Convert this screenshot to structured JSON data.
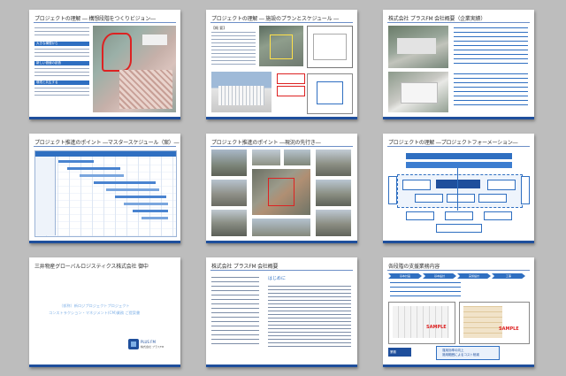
{
  "slides": [
    {
      "title": "プロジェクトの理解 ― 構想段階をつくりビジョン―",
      "bars": [
        "大きな構想から",
        "新しい価値の創造",
        "環境と共生する"
      ]
    },
    {
      "title": "プロジェクトの理解 ― 施設のプランとスケジュール ―",
      "heading": "【概 要】"
    },
    {
      "title": "株式会社 プラスFM 会社概要（企業実績）"
    },
    {
      "title": "プロジェクト推進のポイント ―マスタースケジュール（案）―"
    },
    {
      "title": "プロジェクト推進のポイント ―現況の先行き―"
    },
    {
      "title": "プロジェクトの理解 ―プロジェクトフォーメーション―"
    },
    {
      "title": "三井物産グローバルロジスティクス株式会社 御中",
      "subtitle": "（仮称）新ロジプロジェクトプロジェクト",
      "subtitle2": "コンストラクション・マネジメント(CM)業務 ご提案書",
      "brand": "PLUS FM",
      "company": "株式会社 プラスFM"
    },
    {
      "title": "株式会社 プラスFM 会社概要",
      "heading": "はじめに"
    },
    {
      "title": "各段階の支援業務内容",
      "steps": [
        "基本計画",
        "基本設計",
        "実施設計",
        "工事"
      ],
      "sample": "SAMPLE",
      "bottom_left": "業務",
      "bottom_right": "運用効率の向上\n適用範囲によるコスト削減"
    }
  ],
  "colors": {
    "background": "#bdbdbd",
    "accent": "#2f6fc1",
    "accent_dark": "#1f4f9c",
    "red": "#d22222"
  }
}
